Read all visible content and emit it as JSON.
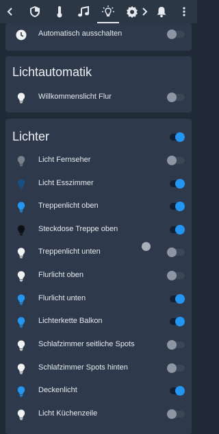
{
  "toolbar": {
    "items": [
      {
        "icon": "chevron-left-icon"
      },
      {
        "icon": "shield-icon"
      },
      {
        "icon": "thermometer-icon"
      },
      {
        "icon": "music-icon"
      },
      {
        "icon": "lightbulb-icon",
        "active": true
      },
      {
        "icon": "badge-icon"
      },
      {
        "icon": "chevron-right-icon"
      },
      {
        "icon": "bell-icon"
      },
      {
        "icon": "more-vert-icon"
      }
    ]
  },
  "colors": {
    "background": "#212b38",
    "card": "#2e3a4b",
    "toolbar": "#2c3746",
    "accent": "#2196f3",
    "bulb_white": "#f2f2f2",
    "bulb_blue": "#2196f3",
    "bulb_dark_blue": "#1a4f86",
    "bulb_gray": "#7a818b",
    "bulb_black": "#0c0f14"
  },
  "card_top": {
    "row": {
      "label": "Automatisch ausschalten",
      "icon": "clock-icon",
      "state": "off"
    }
  },
  "lichtautomatik": {
    "title": "Lichtautomatik",
    "rows": [
      {
        "label": "Willkommenslicht Flur",
        "icon": "lightbulb-icon",
        "bulb": "white",
        "state": "off"
      }
    ]
  },
  "lichter": {
    "title": "Lichter",
    "master_state": "on",
    "rows": [
      {
        "label": "Licht Fernseher",
        "bulb": "gray",
        "state": "off"
      },
      {
        "label": "Licht Esszimmer",
        "bulb": "dark_blue",
        "state": "on"
      },
      {
        "label": "Treppenlicht oben",
        "bulb": "blue",
        "state": "on"
      },
      {
        "label": "Steckdose Treppe oben",
        "bulb": "black",
        "state": "on"
      },
      {
        "label": "Treppenlicht unten",
        "bulb": "white",
        "state": "off"
      },
      {
        "label": "Flurlicht oben",
        "bulb": "white",
        "state": "off"
      },
      {
        "label": "Flurlicht unten",
        "bulb": "blue",
        "state": "on"
      },
      {
        "label": "Lichterkette Balkon",
        "bulb": "blue",
        "state": "on"
      },
      {
        "label": "Schlafzimmer seitliche Spots",
        "bulb": "white",
        "state": "off"
      },
      {
        "label": "Schlafzimmer Spots hinten",
        "bulb": "white",
        "state": "off"
      },
      {
        "label": "Deckenlicht",
        "bulb": "blue",
        "state": "on"
      },
      {
        "label": "Licht Küchenzeile",
        "bulb": "white",
        "state": "off"
      }
    ]
  }
}
